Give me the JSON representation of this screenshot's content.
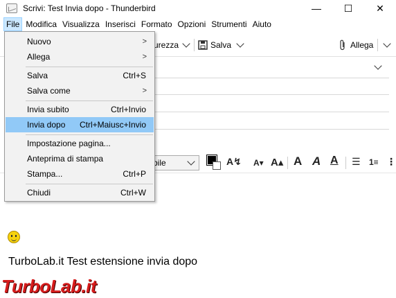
{
  "window": {
    "title": "Scrivi: Test Invia dopo - Thunderbird",
    "minimize": "—",
    "maximize": "☐",
    "close": "✕"
  },
  "menubar": [
    "File",
    "Modifica",
    "Visualizza",
    "Inserisci",
    "Formato",
    "Opzioni",
    "Strumenti",
    "Aiuto"
  ],
  "toolbar": {
    "security_label": "urezza",
    "save_label": "Salva",
    "attach_label": "Allega"
  },
  "format": {
    "font_value": "bile"
  },
  "file_menu": {
    "items": [
      {
        "label": "Nuovo",
        "shortcut": "",
        "submenu": true
      },
      {
        "label": "Allega",
        "shortcut": "",
        "submenu": true
      },
      {
        "label": "Salva",
        "shortcut": "Ctrl+S",
        "submenu": false
      },
      {
        "label": "Salva come",
        "shortcut": "",
        "submenu": true
      },
      {
        "label": "Invia subito",
        "shortcut": "Ctrl+Invio",
        "submenu": false
      },
      {
        "label": "Invia dopo",
        "shortcut": "Ctrl+Maiusc+Invio",
        "submenu": false
      },
      {
        "label": "Impostazione pagina...",
        "shortcut": "",
        "submenu": false
      },
      {
        "label": "Anteprima di stampa",
        "shortcut": "",
        "submenu": false
      },
      {
        "label": "Stampa...",
        "shortcut": "Ctrl+P",
        "submenu": false
      },
      {
        "label": "Chiudi",
        "shortcut": "Ctrl+W",
        "submenu": false
      }
    ],
    "highlighted_index": 5
  },
  "body": {
    "text": "TurboLab.it Test estensione invia dopo"
  },
  "watermark": {
    "text": "TurboLab.it"
  },
  "colors": {
    "highlight": "#91c9f7",
    "menu_active": "#cce8ff",
    "watermark": "#d61c1c"
  }
}
